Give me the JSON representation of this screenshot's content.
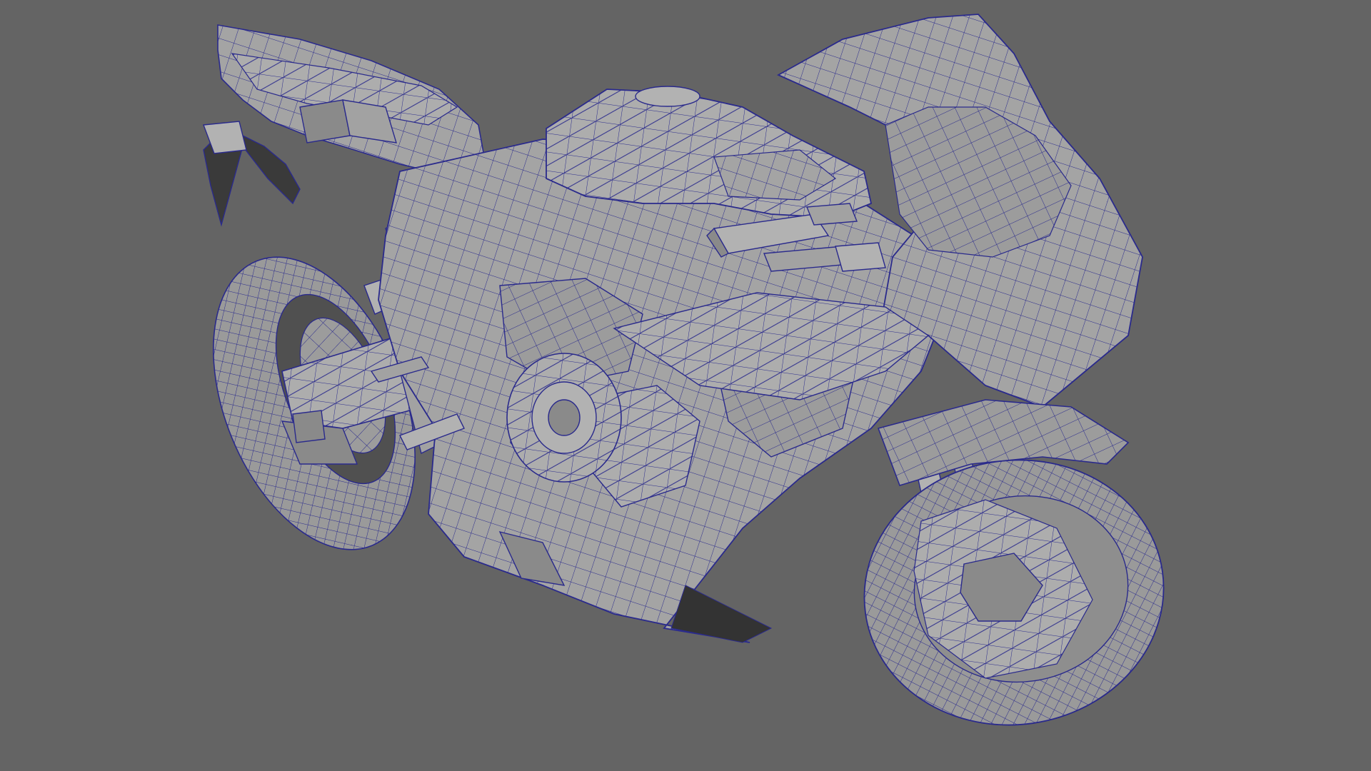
{
  "viewport": {
    "background_color": "#646464",
    "mesh_fill_color": "#a2a2a2",
    "wireframe_color": "#2a2a8c",
    "subject": "motorcycle-mesh"
  }
}
